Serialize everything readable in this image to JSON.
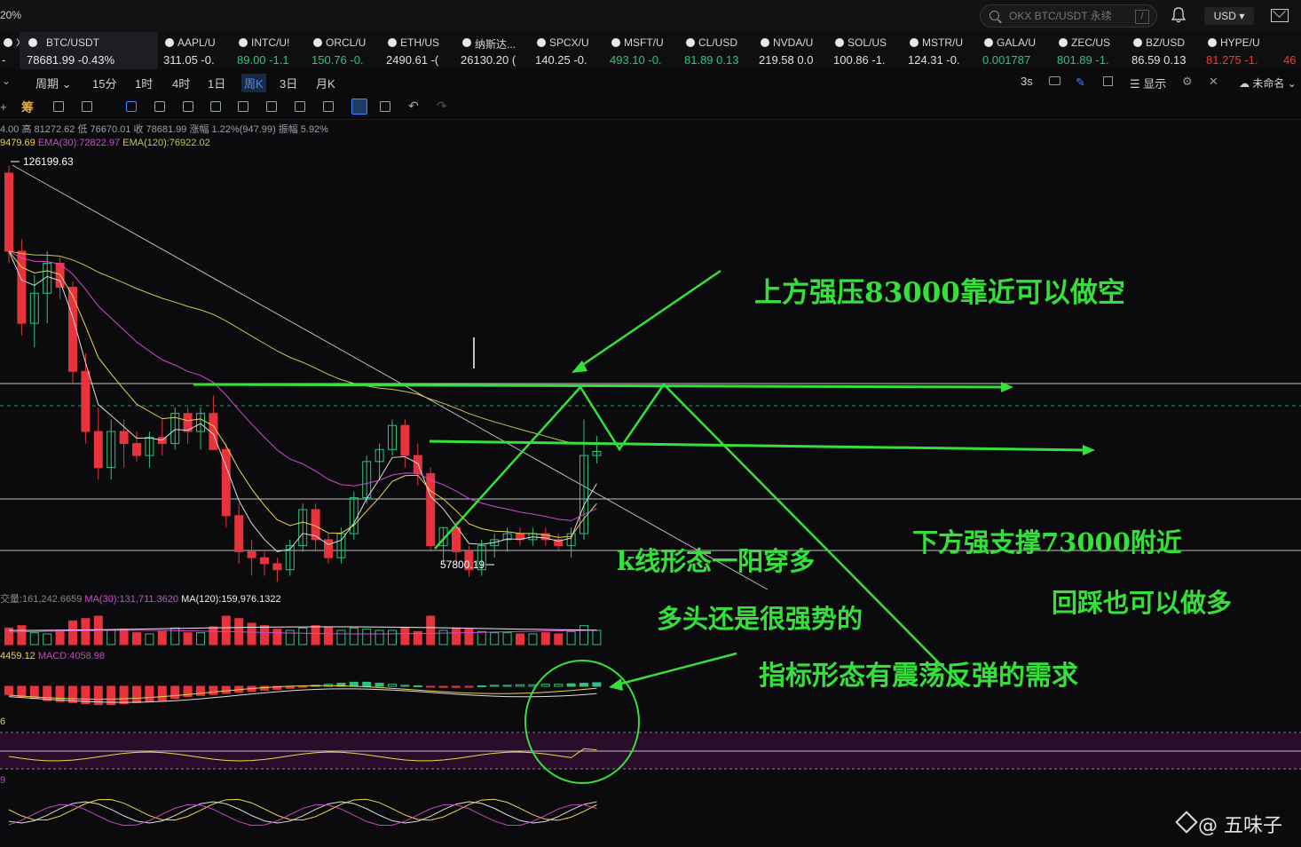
{
  "topbar": {
    "zoom_pct": "20%",
    "search_placeholder": "OKX BTC/USDT 永续",
    "search_slash": "/",
    "currency": "USD"
  },
  "tickers": [
    {
      "name": "X/U",
      "price": "-",
      "chg": "",
      "up": false
    },
    {
      "name": "BTC/USDT",
      "price": "78681.99",
      "chg": "-0.43%",
      "up": false,
      "selected": true
    },
    {
      "name": "AAPL/U",
      "price": "311.05",
      "chg": "-0.",
      "up": false
    },
    {
      "name": "INTC/U!",
      "price": "89.00",
      "chg": "-1.1",
      "up": true
    },
    {
      "name": "ORCL/U",
      "price": "150.76",
      "chg": "-0.",
      "up": true
    },
    {
      "name": "ETH/US",
      "price": "2490.61",
      "chg": "-(",
      "up": false
    },
    {
      "name": "纳斯达...",
      "price": "26130.20",
      "chg": "(",
      "up": false
    },
    {
      "name": "SPCX/U",
      "price": "140.25",
      "chg": "-0.",
      "up": false
    },
    {
      "name": "MSFT/U",
      "price": "493.10",
      "chg": "-0.",
      "up": true
    },
    {
      "name": "CL/USD",
      "price": "81.89",
      "chg": "0.13",
      "up": true
    },
    {
      "name": "NVDA/U",
      "price": "219.58",
      "chg": "0.0",
      "up": false
    },
    {
      "name": "SOL/US",
      "price": "100.86",
      "chg": "-1.",
      "up": false
    },
    {
      "name": "MSTR/U",
      "price": "124.31",
      "chg": "-0.",
      "up": false
    },
    {
      "name": "GALA/U",
      "price": "0.001787",
      "chg": "",
      "up": true
    },
    {
      "name": "ZEC/US",
      "price": "801.89",
      "chg": "-1.",
      "up": true
    },
    {
      "name": "BZ/USD",
      "price": "86.59",
      "chg": "0.13",
      "up": false
    },
    {
      "name": "HYPE/U",
      "price": "81.275",
      "chg": "-1.",
      "up": false,
      "red": true
    },
    {
      "name": "",
      "price": "46",
      "chg": "",
      "up": false,
      "red": true
    }
  ],
  "timeframes": [
    "周期",
    "15分",
    "1时",
    "4时",
    "1日",
    "周K",
    "3日",
    "月K"
  ],
  "active_timeframe": "周K",
  "toolbar_right": {
    "refresh": "3s",
    "display": "显示",
    "unnamed": "未命名"
  },
  "ohlc_line": "4.00 高 81272.62 低 76670.01 收 78681.99 涨幅 1.22%(947.99) 振幅 5.92%",
  "ema_line": {
    "ema_a": "9479.69",
    "ema30": "EMA(30):72822.97",
    "ema120": "EMA(120):76922.02"
  },
  "volume_line": {
    "vol": "交量:161,242.6659",
    "ma30": "MA(30):131,711.3620",
    "ma120": "MA(120):159,976.1322"
  },
  "macd_line": {
    "dif": "4459.12",
    "macd": "MACD:4058.98"
  },
  "rsi_label": "6",
  "kdj_label": "9",
  "chart_data": {
    "type": "candlestick",
    "y_range": [
      56000,
      134000
    ],
    "high_label": "126199.63",
    "low_label": "57800.19",
    "current_price": 78681.99,
    "levels": [
      83000,
      73000
    ],
    "candles": [
      [
        125000,
        126199,
        110000,
        112000
      ],
      [
        112000,
        114000,
        98000,
        100000
      ],
      [
        100000,
        108000,
        96000,
        105000
      ],
      [
        105000,
        112000,
        100000,
        110000
      ],
      [
        110000,
        111000,
        104000,
        106000
      ],
      [
        106000,
        107000,
        90000,
        92000
      ],
      [
        92000,
        95000,
        80000,
        82000
      ],
      [
        82000,
        86000,
        74000,
        76000
      ],
      [
        76000,
        84000,
        74000,
        82000
      ],
      [
        82000,
        84000,
        76000,
        80000
      ],
      [
        80000,
        82000,
        77000,
        78000
      ],
      [
        78000,
        82000,
        76000,
        81000
      ],
      [
        81000,
        84000,
        78000,
        80000
      ],
      [
        80000,
        86000,
        79000,
        85000
      ],
      [
        85000,
        86000,
        80000,
        82000
      ],
      [
        82000,
        86000,
        79000,
        85000
      ],
      [
        85000,
        88000,
        80000,
        79000
      ],
      [
        79000,
        80000,
        66000,
        68000
      ],
      [
        68000,
        70000,
        60000,
        62000
      ],
      [
        62000,
        64000,
        58000,
        61000
      ],
      [
        61000,
        62000,
        58000,
        60000
      ],
      [
        60000,
        61000,
        57000,
        59000
      ],
      [
        59000,
        64000,
        58000,
        63000
      ],
      [
        63000,
        70000,
        62000,
        69000
      ],
      [
        69000,
        70000,
        62000,
        64000
      ],
      [
        64000,
        65000,
        60000,
        61000
      ],
      [
        61000,
        66000,
        60000,
        65000
      ],
      [
        65000,
        72000,
        64000,
        71000
      ],
      [
        71000,
        78000,
        70000,
        77000
      ],
      [
        77000,
        80000,
        74000,
        79000
      ],
      [
        79000,
        84000,
        78000,
        83000
      ],
      [
        83000,
        84000,
        76000,
        78000
      ],
      [
        78000,
        80000,
        73000,
        75000
      ],
      [
        75000,
        76000,
        62000,
        63000
      ],
      [
        63000,
        66000,
        60000,
        66000
      ],
      [
        66000,
        67000,
        60000,
        62000
      ],
      [
        62000,
        63000,
        57800,
        59000
      ],
      [
        59000,
        64000,
        58000,
        63000
      ],
      [
        63000,
        65000,
        61000,
        64000
      ],
      [
        64000,
        66000,
        62000,
        65000
      ],
      [
        65000,
        66000,
        63000,
        64000
      ],
      [
        64000,
        66000,
        63000,
        65000
      ],
      [
        65000,
        66000,
        63000,
        64000
      ],
      [
        64000,
        65000,
        62000,
        63000
      ],
      [
        63000,
        66000,
        61000,
        65000
      ],
      [
        65000,
        84000,
        64000,
        78000
      ],
      [
        78000,
        81272,
        76670,
        78682
      ]
    ],
    "volumes": [
      14,
      16,
      10,
      9,
      12,
      20,
      22,
      24,
      12,
      13,
      10,
      9,
      11,
      14,
      10,
      10,
      15,
      24,
      22,
      18,
      16,
      13,
      12,
      14,
      16,
      15,
      12,
      14,
      13,
      12,
      12,
      14,
      11,
      24,
      12,
      14,
      13,
      11,
      10,
      10,
      9,
      9,
      10,
      9,
      11,
      16,
      12
    ],
    "macd_hist": [
      -8,
      -10,
      -12,
      -14,
      -15,
      -16,
      -17,
      -18,
      -18,
      -17,
      -16,
      -15,
      -14,
      -12,
      -10,
      -9,
      -8,
      -7,
      -6,
      -5,
      -4,
      -3,
      -2,
      -1,
      1,
      2,
      3,
      4,
      4,
      3,
      2,
      1,
      0.5,
      -0.5,
      -1,
      -1,
      -0.5,
      0.5,
      1,
      1,
      1.5,
      1.5,
      2,
      2,
      2.5,
      3,
      3.5
    ]
  },
  "annotations": {
    "resistance": "上方强压83000靠近可以做空",
    "support": "下方强支撑73000附近",
    "pattern": "k线形态一阳穿多",
    "bull": "多头还是很强势的",
    "indicator": "指标形态有震荡反弹的需求",
    "pullback": "回踩也可以做多"
  },
  "watermark": "@ 五味子"
}
